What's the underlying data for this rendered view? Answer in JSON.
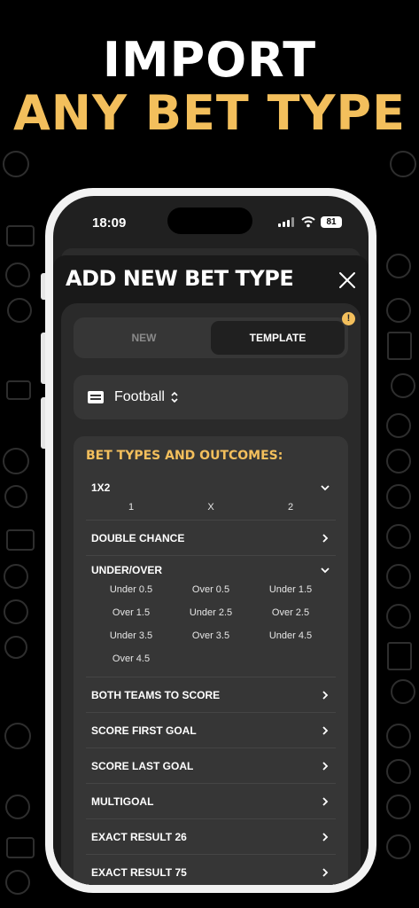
{
  "headline": {
    "line1": "IMPORT",
    "line2": "ANY BET TYPE"
  },
  "colors": {
    "accent": "#f3bf5c",
    "sheet": "#191919",
    "panel": "#2a2a2a"
  },
  "status_bar": {
    "time": "18:09",
    "battery": "81"
  },
  "sheet": {
    "title": "ADD NEW BET TYPE",
    "close_icon": "close-icon"
  },
  "tabs": {
    "new": "NEW",
    "template": "TEMPLATE",
    "active": "TEMPLATE",
    "info_badge": "!"
  },
  "sport": {
    "icon": "list-icon",
    "value": "Football"
  },
  "bet_types": {
    "title": "BET TYPES AND OUTCOMES:",
    "items": [
      {
        "label": "1X2",
        "expanded": true,
        "outcomes": [
          "1",
          "X",
          "2"
        ]
      },
      {
        "label": "DOUBLE CHANCE",
        "expanded": false
      },
      {
        "label": "UNDER/OVER",
        "expanded": true,
        "outcomes": [
          "Under 0.5",
          "Over 0.5",
          "Under 1.5",
          "Over 1.5",
          "Under 2.5",
          "Over 2.5",
          "Under 3.5",
          "Over 3.5",
          "Under 4.5",
          "Over 4.5"
        ]
      },
      {
        "label": "BOTH TEAMS TO SCORE",
        "expanded": false
      },
      {
        "label": "SCORE FIRST GOAL",
        "expanded": false
      },
      {
        "label": "SCORE LAST GOAL",
        "expanded": false
      },
      {
        "label": "MULTIGOAL",
        "expanded": false
      },
      {
        "label": "EXACT RESULT 26",
        "expanded": false
      },
      {
        "label": "EXACT RESULT 75",
        "expanded": false
      }
    ]
  }
}
